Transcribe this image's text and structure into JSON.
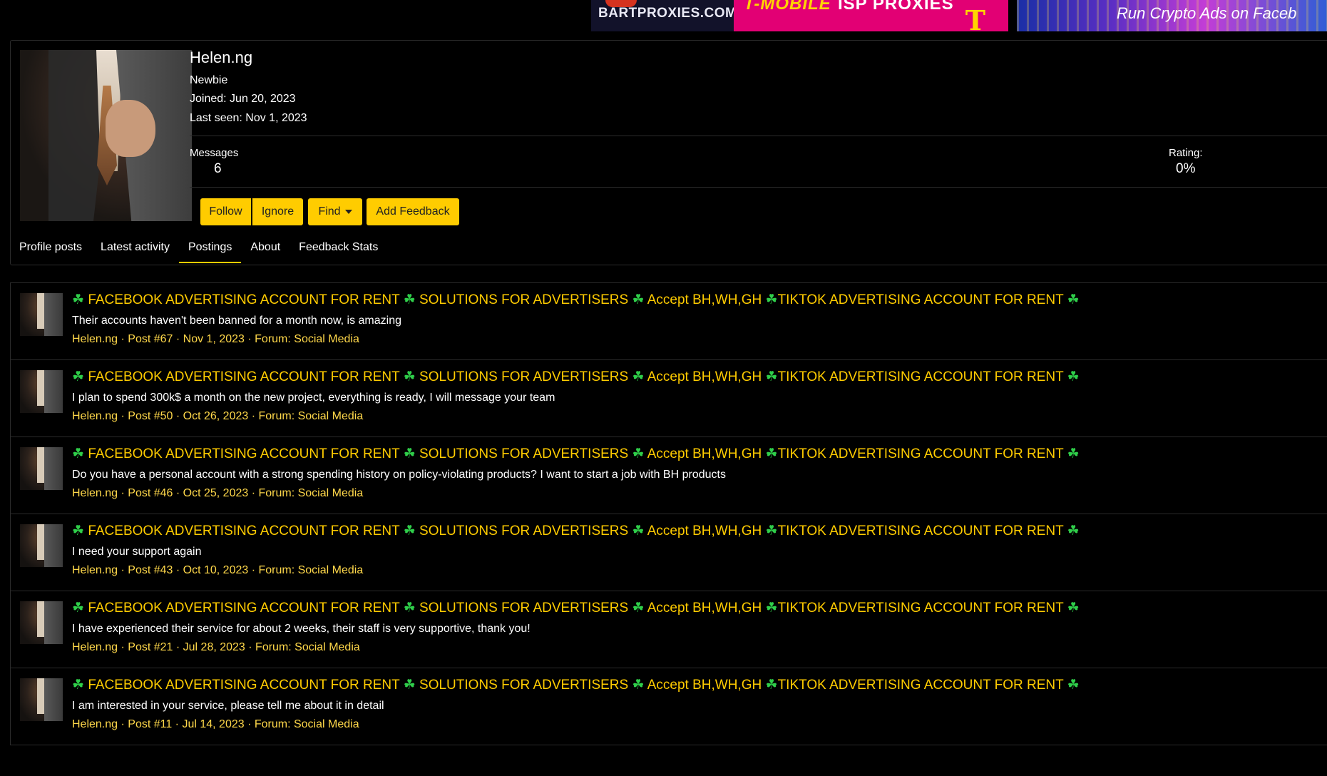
{
  "banners": {
    "bart": {
      "text": "BARTPROXIES.COM"
    },
    "tmobile": {
      "brand": "T-MOBILE",
      "text": "ISP PROXIES",
      "logo": "T"
    },
    "crypto": {
      "text": "Run Crypto Ads on Faceb"
    }
  },
  "profile": {
    "name": "Helen.ng",
    "title": "Newbie",
    "joined": "Joined: Jun 20, 2023",
    "last_seen": "Last seen: Nov 1, 2023",
    "messages_label": "Messages",
    "messages_value": "6",
    "rating_label": "Rating:",
    "rating_value": "0%"
  },
  "actions": {
    "follow": "Follow",
    "ignore": "Ignore",
    "find": "Find",
    "add_feedback": "Add Feedback"
  },
  "tabs": [
    {
      "label": "Profile posts"
    },
    {
      "label": "Latest activity"
    },
    {
      "label": "Postings",
      "active": true
    },
    {
      "label": "About"
    },
    {
      "label": "Feedback Stats"
    }
  ],
  "thread_title": {
    "clover": "☘",
    "p1": "FACEBOOK ADVERTISING ACCOUNT FOR RENT",
    "p2": "SOLUTIONS FOR ADVERTISERS",
    "p3": "Accept BH,WH,GH",
    "p4": "TIKTOK ADVERTISING ACCOUNT FOR RENT"
  },
  "posts": [
    {
      "snippet": "Their accounts haven't been banned for a month now, is amazing",
      "author": "Helen.ng",
      "post": "Post #67",
      "date": "Nov 1, 2023",
      "forum_label": "Forum:",
      "forum": "Social Media"
    },
    {
      "snippet": "I plan to spend 300k$ a month on the new project, everything is ready, I will message your team",
      "author": "Helen.ng",
      "post": "Post #50",
      "date": "Oct 26, 2023",
      "forum_label": "Forum:",
      "forum": "Social Media"
    },
    {
      "snippet": "Do you have a personal account with a strong spending history on policy-violating products? I want to start a job with BH products",
      "author": "Helen.ng",
      "post": "Post #46",
      "date": "Oct 25, 2023",
      "forum_label": "Forum:",
      "forum": "Social Media"
    },
    {
      "snippet": "I need your support again",
      "author": "Helen.ng",
      "post": "Post #43",
      "date": "Oct 10, 2023",
      "forum_label": "Forum:",
      "forum": "Social Media"
    },
    {
      "snippet": "I have experienced their service for about 2 weeks, their staff is very supportive, thank you!",
      "author": "Helen.ng",
      "post": "Post #21",
      "date": "Jul 28, 2023",
      "forum_label": "Forum:",
      "forum": "Social Media"
    },
    {
      "snippet": "I am interested in your service, please tell me about it in detail",
      "author": "Helen.ng",
      "post": "Post #11",
      "date": "Jul 14, 2023",
      "forum_label": "Forum:",
      "forum": "Social Media"
    }
  ]
}
